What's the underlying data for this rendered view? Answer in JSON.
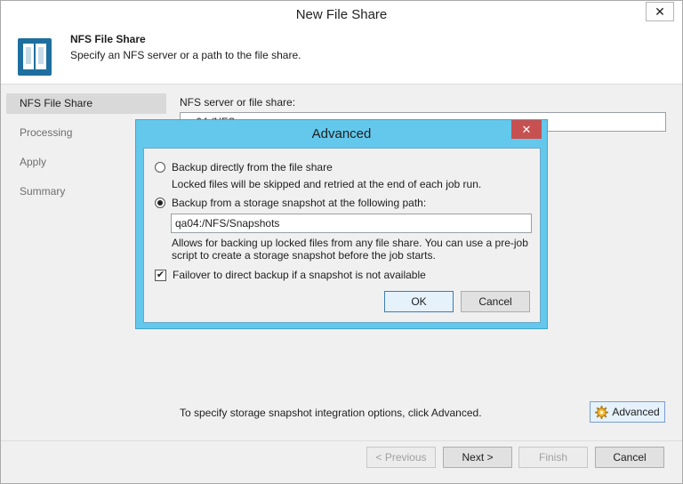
{
  "window": {
    "title": "New File Share",
    "close": "✕"
  },
  "header": {
    "title": "NFS File Share",
    "subtitle": "Specify an NFS server or a path to the file share."
  },
  "sidebar": {
    "items": [
      {
        "label": "NFS File Share",
        "active": true
      },
      {
        "label": "Processing",
        "active": false
      },
      {
        "label": "Apply",
        "active": false
      },
      {
        "label": "Summary",
        "active": false
      }
    ]
  },
  "main": {
    "server_label": "NFS server or file share:",
    "server_value": "qa04:/NFS",
    "hint": "To specify storage snapshot integration options, click Advanced.",
    "advanced_button": "Advanced"
  },
  "footer": {
    "previous": "< Previous",
    "next": "Next >",
    "finish": "Finish",
    "cancel": "Cancel"
  },
  "advanced_dialog": {
    "title": "Advanced",
    "close": "✕",
    "option_direct": {
      "label": "Backup directly from the file share",
      "description": "Locked files will be skipped and retried at the end of each job run.",
      "selected": false
    },
    "option_snapshot": {
      "label": "Backup from a storage snapshot at the following path:",
      "path": "qa04:/NFS/Snapshots",
      "description_1": "Allows for backing up locked files from any file share. You can use a pre-job",
      "description_2": "script to create a storage snapshot before the job starts.",
      "selected": true
    },
    "failover": {
      "label": "Failover to direct backup if a snapshot is not available",
      "checked": true
    },
    "ok": "OK",
    "cancel": "Cancel"
  },
  "colors": {
    "dialog_frame": "#64c8ec",
    "dialog_close": "#c75050",
    "icon_blue": "#1e6f9f"
  }
}
